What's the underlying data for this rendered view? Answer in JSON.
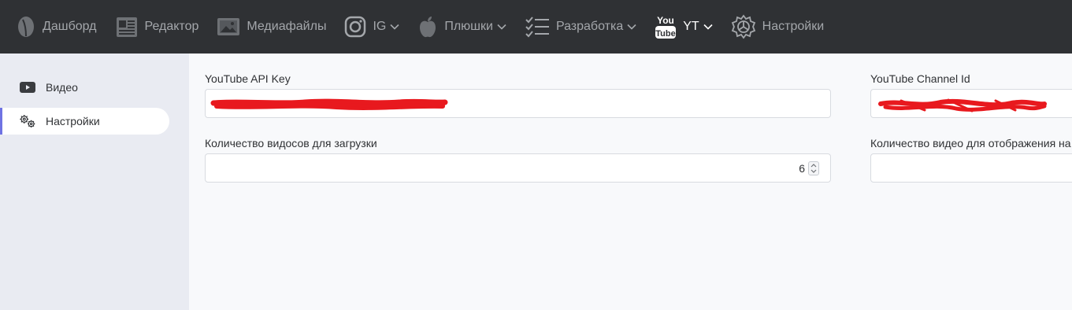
{
  "topnav": {
    "items": [
      {
        "label": "Дашборд",
        "icon": "leaf-icon"
      },
      {
        "label": "Редактор",
        "icon": "newspaper-icon"
      },
      {
        "label": "Медиафайлы",
        "icon": "image-icon"
      },
      {
        "label": "IG",
        "icon": "instagram-icon",
        "dropdown": true
      },
      {
        "label": "Плюшки",
        "icon": "apple-icon",
        "dropdown": true
      },
      {
        "label": "Разработка",
        "icon": "checklist-icon",
        "dropdown": true
      },
      {
        "label": "YT",
        "icon": "youtube-icon",
        "dropdown": true,
        "active": true
      },
      {
        "label": "Настройки",
        "icon": "gear-icon"
      }
    ],
    "youtube_logo_top": "You",
    "youtube_logo_bottom": "Tube"
  },
  "sidebar": {
    "items": [
      {
        "label": "Видео",
        "icon": "play-icon"
      },
      {
        "label": "Настройки",
        "icon": "gears-icon",
        "active": true
      }
    ]
  },
  "form": {
    "api_key_label": "YouTube API Key",
    "channel_id_label": "YouTube Channel Id",
    "download_count_label": "Количество видосов для загрузки",
    "download_count_value": "6",
    "display_count_label": "Количество видео для отображения на с"
  },
  "colors": {
    "topbar": "#2f3134",
    "sidebar": "#e9ebf2",
    "accent": "#6f73e3",
    "redaction": "#e8191e"
  }
}
